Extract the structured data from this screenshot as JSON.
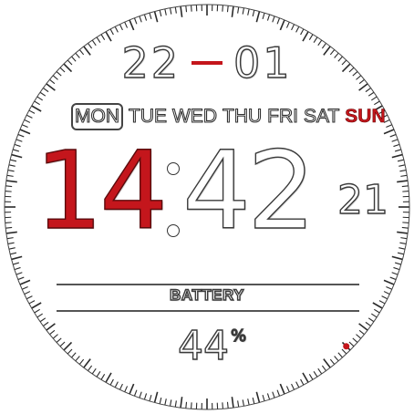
{
  "date": {
    "day": "22",
    "month": "01"
  },
  "weekdays": [
    {
      "label": "MON",
      "active": true,
      "sunday": false
    },
    {
      "label": "TUE",
      "active": false,
      "sunday": false
    },
    {
      "label": "WED",
      "active": false,
      "sunday": false
    },
    {
      "label": "THU",
      "active": false,
      "sunday": false
    },
    {
      "label": "FRI",
      "active": false,
      "sunday": false
    },
    {
      "label": "SAT",
      "active": false,
      "sunday": false
    },
    {
      "label": "SUN",
      "active": false,
      "sunday": true
    }
  ],
  "time": {
    "hour": "14",
    "minute": "42",
    "second": "21"
  },
  "battery": {
    "label": "BATTERY",
    "value": "44",
    "unit": "%"
  },
  "colors": {
    "accent": "#c4161c",
    "outline": "#333333",
    "background": "#ffffff"
  },
  "dial": {
    "tick_count": 240,
    "marker_fraction": 0.375
  }
}
